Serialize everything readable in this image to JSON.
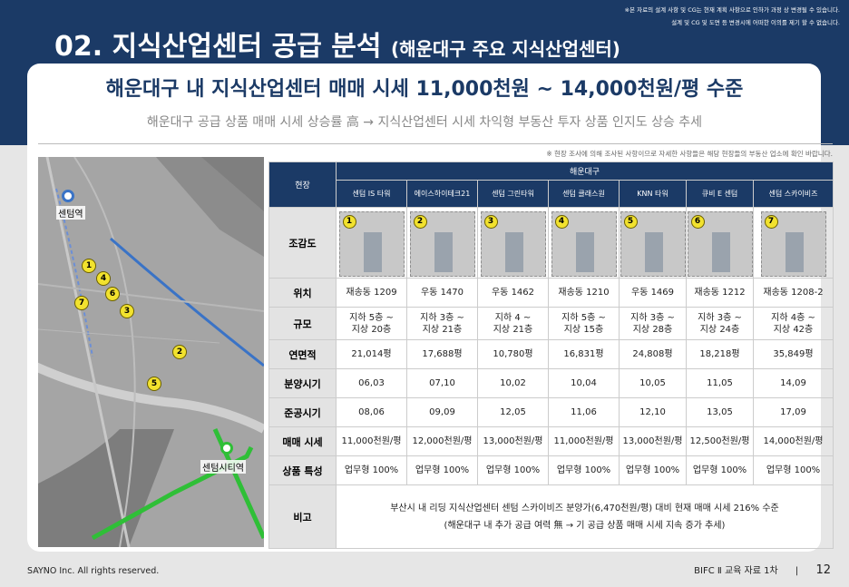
{
  "disclaimer": {
    "line1": "※본 자료의 설계 사항 및 CG는 현재 계획 사항으로 인하가 과정 상 변경될 수 있습니다.",
    "line2": "설계 및 CG 및 도면 등 변경시에 어떠한 이의를 제기 할 수 없습니다."
  },
  "title": {
    "main": "02. 지식산업센터 공급 분석",
    "sub": "(해운대구 주요 지식산업센터)"
  },
  "headline": "해운대구 내 지식산업센터 매매 시세 11,000천원 ~ 14,000천원/평 수준",
  "subheadline": "해운대구 공급 상품 매매 시세 상승률 高 → 지식산업센터 시세 차익형 부동산 투자 상품 인지도 상승 추세",
  "survey_note": "※ 현장 조사에 의해 조사된 사항이므로 자세한 사항들은 해당 현장들의 부동산 업소에 확인 바랍니다.",
  "map": {
    "station_top": "센텀역",
    "station_bottom": "센텀시티역",
    "pins": [
      "1",
      "4",
      "6",
      "7",
      "3",
      "2",
      "5"
    ]
  },
  "table": {
    "corner": "현장",
    "group": "해운대구",
    "sites": [
      "센텀 IS 타워",
      "에이스하이테크21",
      "센텀 그린타워",
      "센텀 클래스원",
      "KNN 타워",
      "큐비 E 센텀",
      "센텀 스카이비즈"
    ],
    "site_numbers": [
      "1",
      "2",
      "3",
      "4",
      "5",
      "6",
      "7"
    ],
    "row_labels": {
      "aerial": "조감도",
      "location": "위치",
      "scale": "규모",
      "area": "연면적",
      "sale": "분양시기",
      "complete": "준공시기",
      "price": "매매 시세",
      "feature": "상품 특성",
      "remark": "비고"
    },
    "location": [
      "재송동 1209",
      "우동 1470",
      "우동 1462",
      "재송동 1210",
      "우동 1469",
      "재송동 1212",
      "재송동 1208-2"
    ],
    "scale_below": [
      "지하 5층 ~",
      "지하 3층 ~",
      "지하 4 ~",
      "지하 5층 ~",
      "지하 3층 ~",
      "지하 3층 ~",
      "지하 4층 ~"
    ],
    "scale_above": [
      "지상 20층",
      "지상 21층",
      "지상 21층",
      "지상 15층",
      "지상 28층",
      "지상 24층",
      "지상 42층"
    ],
    "area": [
      "21,014평",
      "17,688평",
      "10,780평",
      "16,831평",
      "24,808평",
      "18,218평",
      "35,849평"
    ],
    "sale": [
      "06,03",
      "07,10",
      "10,02",
      "10,04",
      "10,05",
      "11,05",
      "14,09"
    ],
    "complete": [
      "08,06",
      "09,09",
      "12,05",
      "11,06",
      "12,10",
      "13,05",
      "17,09"
    ],
    "price": [
      "11,000천원/평",
      "12,000천원/평",
      "13,000천원/평",
      "11,000천원/평",
      "13,000천원/평",
      "12,500천원/평",
      "14,000천원/평"
    ],
    "feature": [
      "업무형 100%",
      "업무형 100%",
      "업무형 100%",
      "업무형 100%",
      "업무형 100%",
      "업무형 100%",
      "업무형 100%"
    ],
    "remark_line1": "부산시 내 리딩 지식산업센터 센텀 스카이비즈 분양가(6,470천원/평) 대비 현재 매매 시세 216% 수준",
    "remark_line2": "(해운대구 내 추가 공급 여력 無 → 기 공급 상품 매매 시세 지속 증가 추세)"
  },
  "footer": {
    "copyright": "SAYNO Inc. All rights reserved.",
    "doc": "BIFC Ⅱ 교육 자료 1차",
    "separator": "|",
    "page": "12"
  }
}
